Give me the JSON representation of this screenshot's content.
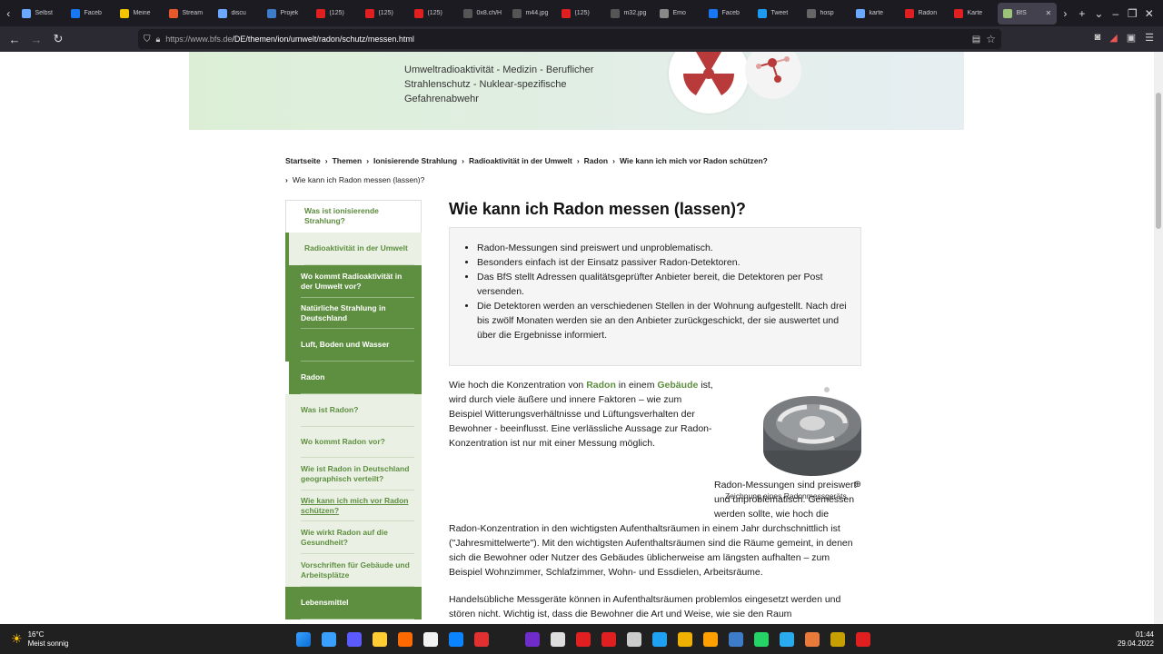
{
  "browser": {
    "tabs": [
      {
        "label": "Selbst",
        "color": "#6aa9ff"
      },
      {
        "label": "Faceb",
        "color": "#1877f2"
      },
      {
        "label": "Meine",
        "color": "#f5c400"
      },
      {
        "label": "Stream",
        "color": "#e85a2b"
      },
      {
        "label": "discu",
        "color": "#6aa9ff"
      },
      {
        "label": "Projek",
        "color": "#3d7cc9"
      },
      {
        "label": "(125)",
        "color": "#e02020"
      },
      {
        "label": "(125)",
        "color": "#e02020"
      },
      {
        "label": "(125)",
        "color": "#e02020"
      },
      {
        "label": "0x8.ch/Ho",
        "color": "#555"
      },
      {
        "label": "m44.jpg",
        "color": "#555"
      },
      {
        "label": "(125)",
        "color": "#e02020"
      },
      {
        "label": "m32.jpg",
        "color": "#555"
      },
      {
        "label": "Emo",
        "color": "#888"
      },
      {
        "label": "Faceb",
        "color": "#1877f2"
      },
      {
        "label": "Tweet",
        "color": "#1d9bf0"
      },
      {
        "label": "hosp",
        "color": "#666"
      },
      {
        "label": "karte",
        "color": "#6aa9ff"
      },
      {
        "label": "Radon",
        "color": "#e02020"
      },
      {
        "label": "Karte",
        "color": "#e02020"
      },
      {
        "label": "BfS",
        "color": "#9dc27a"
      }
    ],
    "url_host": "https://www.bfs.de",
    "url_path": "/DE/themen/ion/umwelt/radon/schutz/messen.html"
  },
  "banner": {
    "text": "Umweltradioaktivität - Medizin - Beruflicher Strahlenschutz - Nuklear-spezifische Gefahrenabwehr"
  },
  "breadcrumb": {
    "items": [
      "Startseite",
      "Themen",
      "Ionisierende Strahlung",
      "Radioaktivität in der Umwelt",
      "Radon",
      "Wie kann ich mich vor Radon schützen?"
    ],
    "current": "Wie kann ich Radon messen (lassen)?"
  },
  "sidenav": [
    {
      "label": "Was ist ionisierende Strahlung?",
      "style": "top",
      "h": 36
    },
    {
      "label": "Radioaktivität in der Umwelt",
      "style": "top2",
      "h": 36
    },
    {
      "label": "Wo kommt Radioaktivität in der Umwelt vor?",
      "style": "dark",
      "h": 36
    },
    {
      "label": "Natürliche Strahlung in Deutschland",
      "style": "dark",
      "h": 34
    },
    {
      "label": "Luft, Boden und Wasser",
      "style": "dark",
      "h": 36
    },
    {
      "label": "Radon",
      "style": "dark-sel",
      "h": 36
    },
    {
      "label": "Was ist Radon?",
      "style": "light",
      "h": 36
    },
    {
      "label": "Wo kommt Radon vor?",
      "style": "light",
      "h": 34
    },
    {
      "label": "Wie ist Radon in Deutschland geographisch verteilt?",
      "style": "light",
      "h": 36
    },
    {
      "label": "Wie kann ich mich vor Radon schützen?",
      "style": "light-sel",
      "h": 34
    },
    {
      "label": "Wie wirkt Radon auf die Gesundheit?",
      "style": "light",
      "h": 36
    },
    {
      "label": "Vorschriften für Gebäude und Arbeitsplätze",
      "style": "light",
      "h": 36
    },
    {
      "label": "Lebensmittel",
      "style": "dark",
      "h": 36
    }
  ],
  "main": {
    "title": "Wie kann ich Radon messen (lassen)?",
    "bullets": [
      "Radon-Messungen sind preiswert und unproblematisch.",
      "Besonders einfach ist der Einsatz passiver Radon-Detektoren.",
      "Das BfS stellt Adressen qualitätsgeprüfter Anbieter bereit, die Detektoren per Post versenden.",
      "Die Detektoren werden an verschiedenen Stellen in der Wohnung aufgestellt. Nach drei bis zwölf Monaten werden sie an den Anbieter zurückgeschickt, der sie auswertet und über die Ergebnisse informiert."
    ],
    "p1_a": "Wie hoch die Konzentration von ",
    "p1_link1": "Radon",
    "p1_b": " in einem ",
    "p1_link2": "Gebäude",
    "p1_c": " ist, wird durch viele äußere und innere Faktoren – wie zum Beispiel Witterungsverhältnisse und Lüftungsverhalten der Bewohner - beeinflusst. Eine verlässliche Aussage zur Radon-Konzentration ist nur mit einer Messung möglich.",
    "p2": "Radon-Messungen sind preiswert und unproblematisch. Gemessen werden sollte, wie hoch die Radon-Konzentration in den wichtigsten Aufenthaltsräumen in einem Jahr durchschnittlich ist (\"Jahresmittelwerte\"). Mit den wichtigsten Aufenthaltsräumen sind die Räume gemeint, in denen sich die Bewohner oder Nutzer des Gebäudes üblicherweise am längsten aufhalten – zum Beispiel Wohnzimmer, Schlafzimmer, Wohn- und Essdielen, Arbeitsräume.",
    "p3": "Handelsübliche Messgeräte können in Aufenthaltsräumen problemlos eingesetzt werden und stören nicht. Wichtig ist, dass die Bewohner die Art und Weise, wie sie den Raum",
    "figure_caption": "Zeichnung eines Radonmessgeräts"
  },
  "taskbar": {
    "temp": "16°C",
    "weather": "Meist sonnig",
    "time": "01:44",
    "date": "29.04.2022",
    "icon_colors": [
      "#3aa0ff",
      "#5a5aff",
      "#ffcc33",
      "#ff6a00",
      "#f2f2f2",
      "#0a84ff",
      "#e03030",
      "#202020",
      "#6f2cc9",
      "#ddd",
      "#e02020",
      "#e02020",
      "#ccc",
      "#1ea1f2",
      "#f0b000",
      "#ffa000",
      "#3d7cc9",
      "#25d366",
      "#2aabee",
      "#e87b3b",
      "#c6a000",
      "#e02020"
    ]
  }
}
